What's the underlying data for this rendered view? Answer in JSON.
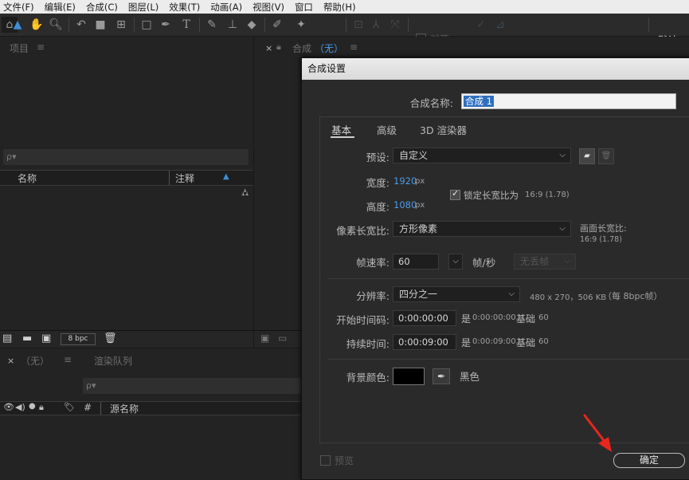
{
  "menu": [
    "文件(F)",
    "编辑(E)",
    "合成(C)",
    "图层(L)",
    "效果(T)",
    "动画(A)",
    "视图(V)",
    "窗口",
    "帮助(H)"
  ],
  "toolbar": {
    "snap_label": "对齐",
    "workspace": "默认"
  },
  "project_panel": {
    "title": "项目",
    "search_placeholder": "ρ▾",
    "col_name": "名称",
    "col_comment": "注释",
    "bpc": "8 bpc"
  },
  "comp_panel": {
    "tab_prefix": "合成",
    "tab_name": "（无）"
  },
  "timeline_panel": {
    "tab_none": "（无）",
    "tab_render": "渲染队列",
    "search_placeholder": "ρ▾",
    "col_hash": "#",
    "col_source": "源名称"
  },
  "dialog": {
    "title": "合成设置",
    "name_label": "合成名称:",
    "name_value": "合成 1",
    "tabs": [
      "基本",
      "高级",
      "3D 渲染器"
    ],
    "preset_label": "预设:",
    "preset_value": "自定义",
    "width_label": "宽度:",
    "width_value": "1920",
    "height_label": "高度:",
    "height_value": "1080",
    "px": "px",
    "lock_label": "锁定长宽比为",
    "lock_ratio": "16:9 (1.78)",
    "par_label": "像素长宽比:",
    "par_value": "方形像素",
    "frame_aspect_label": "画面长宽比:",
    "frame_aspect_value": "16:9 (1.78)",
    "fps_label": "帧速率:",
    "fps_value": "60",
    "fps_unit": "帧/秒",
    "dropframe_value": "无丢帧",
    "res_label": "分辨率:",
    "res_value": "四分之一",
    "res_info_dims": "480 x 270，506 KB",
    "res_info_note": "（每 8bpc帧）",
    "start_label": "开始时间码:",
    "start_value": "0:00:00:00",
    "start_is": "是",
    "start_info": "0:00:00:00",
    "base_label": "基础",
    "base_value": "60",
    "dur_label": "持续时间:",
    "dur_value": "0:00:09:00",
    "dur_is": "是",
    "dur_info": "0:00:09:00",
    "dur_base_label": "基础",
    "dur_base_value": "60",
    "bg_label": "背景颜色:",
    "bg_color_name": "黑色",
    "preview_label": "预览",
    "ok_label": "确定"
  },
  "colors": {
    "accent_blue": "#4d9be6",
    "arrow_red": "#e8261e",
    "selection": "#2f6fc0"
  }
}
